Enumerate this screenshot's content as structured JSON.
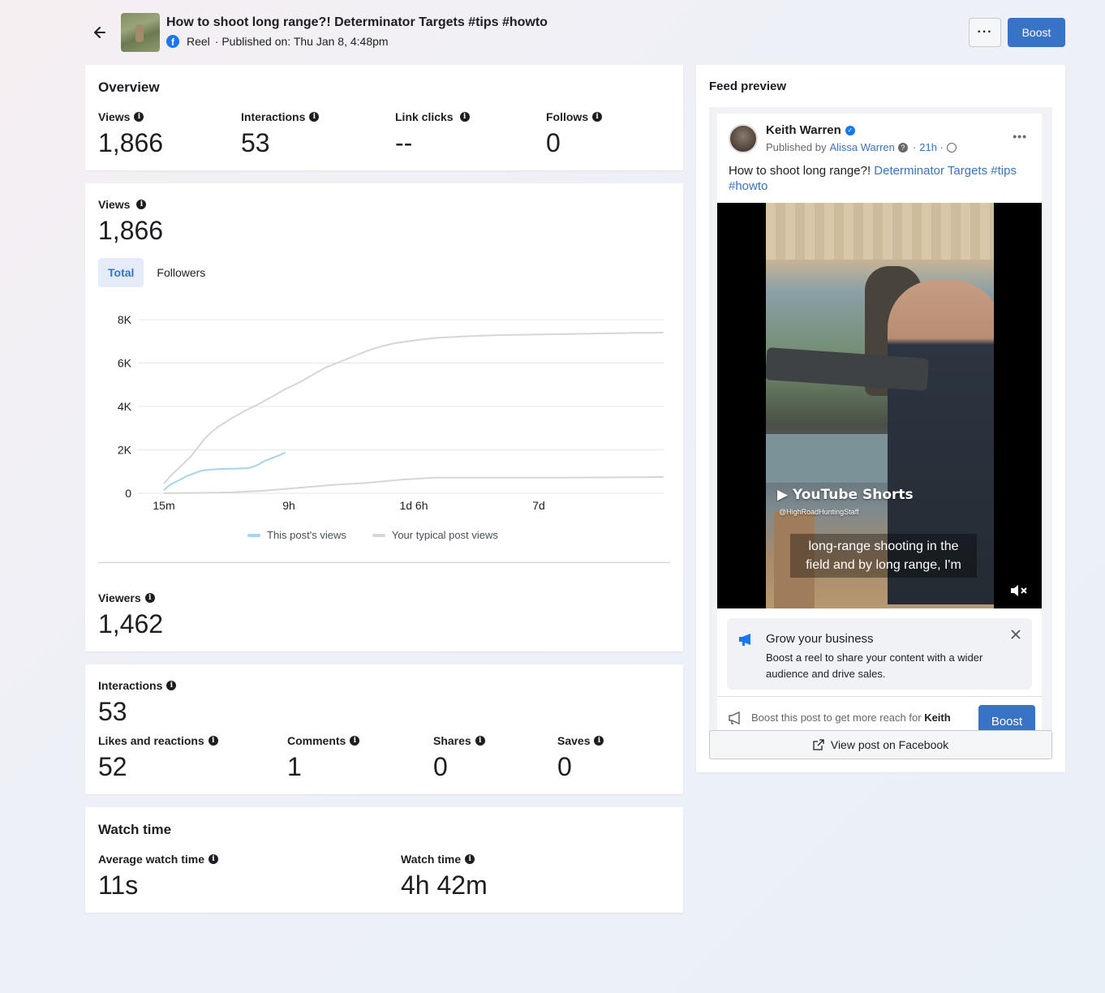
{
  "header": {
    "title": "How to shoot long range?! Determinator Targets #tips #howto",
    "meta_type": "Reel",
    "meta_published": "· Published on: Thu Jan 8, 4:48pm",
    "more_label": "···",
    "boost_label": "Boost"
  },
  "overview": {
    "title": "Overview",
    "metrics": [
      {
        "label": "Views",
        "value": "1,866"
      },
      {
        "label": "Interactions",
        "value": "53"
      },
      {
        "label": "Link clicks",
        "value": "--"
      },
      {
        "label": "Follows",
        "value": "0"
      }
    ]
  },
  "views_card": {
    "label": "Views",
    "value": "1,866",
    "tabs": [
      "Total",
      "Followers"
    ],
    "active_tab": "Total",
    "viewers_label": "Viewers",
    "viewers_value": "1,462"
  },
  "chart_data": {
    "type": "line",
    "x_ticks": [
      "15m",
      "9h",
      "1d 6h",
      "7d"
    ],
    "y_ticks": [
      "0",
      "2K",
      "4K",
      "6K",
      "8K"
    ],
    "ylim": [
      0,
      8000
    ],
    "grid": true,
    "legend_placement": "bottom-center",
    "series": [
      {
        "name": "This post's views",
        "color": "#a8d2ef",
        "x": [
          0,
          0.05,
          0.1,
          0.15,
          0.2,
          0.25,
          0.3,
          0.35,
          0.4,
          0.45,
          0.5,
          0.55,
          0.6,
          0.65,
          0.7,
          0.75,
          0.8,
          0.85,
          0.9,
          0.95,
          1.0,
          1.05,
          1.1,
          1.15,
          1.2,
          1.25,
          1.3,
          1.35,
          1.4,
          1.45,
          1.5,
          1.55,
          1.6,
          1.65,
          1.7,
          1.75,
          1.8
        ],
        "y": [
          150,
          290,
          400,
          490,
          560,
          640,
          730,
          810,
          860,
          920,
          980,
          1030,
          1060,
          1080,
          1090,
          1100,
          1110,
          1120,
          1120,
          1130,
          1130,
          1130,
          1140,
          1150,
          1150,
          1160,
          1200,
          1260,
          1320,
          1420,
          1500,
          1560,
          1620,
          1680,
          1740,
          1810,
          1866
        ]
      },
      {
        "name": "Your typical post views",
        "color": "#d4d6da",
        "x": [
          0,
          0.1,
          0.2,
          0.3,
          0.4,
          0.5,
          0.6,
          0.7,
          0.8,
          0.9,
          1.0,
          1.2,
          1.4,
          1.6,
          1.8,
          2.0,
          2.2,
          2.4,
          2.6,
          2.8,
          3.0,
          3.2,
          3.4,
          3.6,
          3.8,
          4.0,
          4.2,
          4.4,
          4.6,
          4.8,
          5.0,
          5.2,
          5.4,
          5.6,
          5.8,
          6.0,
          6.2,
          6.4,
          6.6,
          6.8,
          7.0,
          7.2,
          7.4
        ],
        "y": [
          450,
          800,
          1100,
          1400,
          1700,
          2100,
          2500,
          2800,
          3050,
          3250,
          3450,
          3800,
          4100,
          4450,
          4800,
          5100,
          5450,
          5800,
          6050,
          6300,
          6550,
          6750,
          6900,
          7000,
          7080,
          7150,
          7190,
          7220,
          7250,
          7270,
          7290,
          7300,
          7310,
          7320,
          7330,
          7340,
          7350,
          7360,
          7370,
          7380,
          7390,
          7395,
          7400
        ]
      },
      {
        "name": "",
        "color": "#d4d6da",
        "x": [
          0,
          0.5,
          1.0,
          1.5,
          2.0,
          2.5,
          3.0,
          3.5,
          4.0,
          4.5,
          5.0,
          5.5,
          6.0,
          6.5,
          7.0,
          7.4
        ],
        "y": [
          0,
          20,
          40,
          120,
          250,
          380,
          480,
          620,
          720,
          720,
          720,
          720,
          720,
          730,
          740,
          750
        ]
      }
    ]
  },
  "interactions_card": {
    "label": "Interactions",
    "value": "53",
    "metrics": [
      {
        "label": "Likes and reactions",
        "value": "52"
      },
      {
        "label": "Comments",
        "value": "1"
      },
      {
        "label": "Shares",
        "value": "0"
      },
      {
        "label": "Saves",
        "value": "0"
      }
    ]
  },
  "watch_time": {
    "title": "Watch time",
    "avg_label": "Average watch time",
    "avg_value": "11s",
    "total_label": "Watch time",
    "total_value": "4h 42m"
  },
  "feed_preview": {
    "title": "Feed preview",
    "author": "Keith Warren",
    "published_by_prefix": "Published by",
    "published_by": "Alissa Warren",
    "time": "21h ·",
    "caption_text": "How to shoot long range?!",
    "caption_link": "Determinator Targets",
    "caption_tags": "#tips #howto",
    "video_brand": "YouTube Shorts",
    "video_handle": "@HighRoadHuntingStaff",
    "video_subtitle": "long-range shooting in the field and by long range, I'm",
    "grow_title": "Grow your business",
    "grow_desc": "Boost a reel to share your content with a wider audience and drive sales.",
    "boost_row_text": "Boost this post to get more reach for",
    "boost_row_name": "Keith",
    "boost_label": "Boost",
    "view_post_label": "View post on Facebook"
  },
  "colors": {
    "accent": "#3873c5",
    "this_post_line": "#a8d2ef",
    "typical_line": "#d4d6da"
  }
}
